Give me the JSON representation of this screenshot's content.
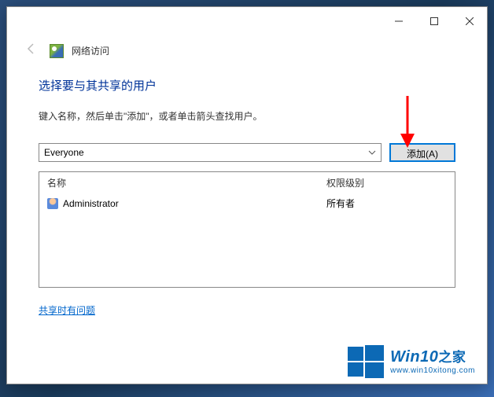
{
  "window": {
    "title": "网络访问",
    "heading": "选择要与其共享的用户",
    "subtext": "键入名称，然后单击\"添加\"，或者单击箭头查找用户。"
  },
  "input": {
    "value": "Everyone"
  },
  "buttons": {
    "add": "添加(A)"
  },
  "table": {
    "col_name": "名称",
    "col_perm": "权限级别",
    "rows": [
      {
        "name": "Administrator",
        "perm": "所有者"
      }
    ]
  },
  "links": {
    "help": "共享时有问题"
  },
  "watermark": {
    "brand": "Win10",
    "brand_zh": "之家",
    "url": "www.win10xitong.com"
  }
}
